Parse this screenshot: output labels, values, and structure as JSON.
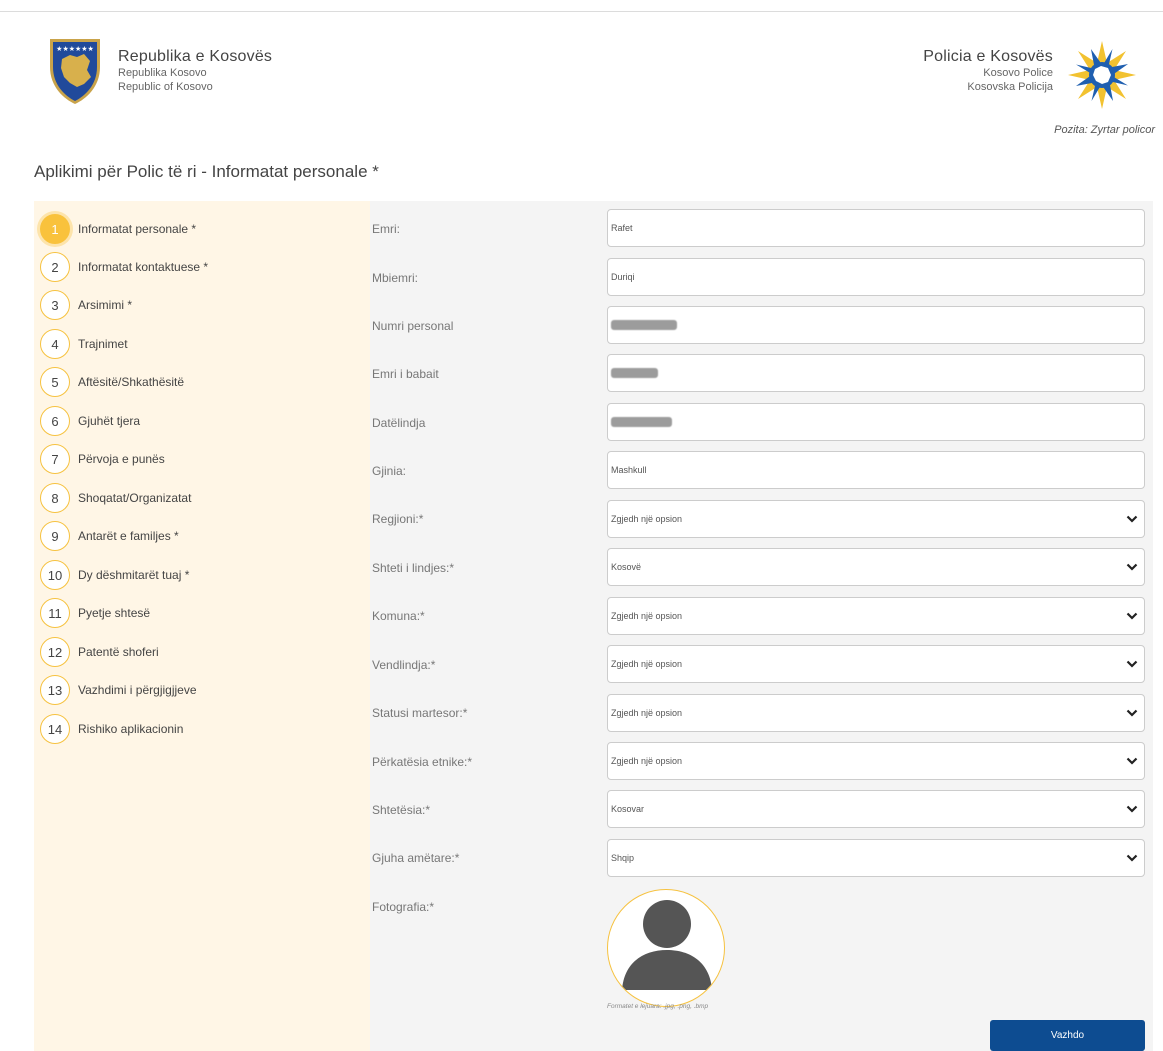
{
  "header": {
    "left": {
      "title": "Republika e Kosovës",
      "sub1": "Republika Kosovo",
      "sub2": "Republic of Kosovo"
    },
    "right": {
      "title": "Policia e Kosovës",
      "sub1": "Kosovo Police",
      "sub2": "Kosovska Policija"
    },
    "pozita": "Pozita: Zyrtar policor"
  },
  "page_title": "Aplikimi për Polic të ri - Informatat personale *",
  "steps": [
    {
      "num": "1",
      "label": "Informatat personale *",
      "active": true
    },
    {
      "num": "2",
      "label": "Informatat kontaktuese *"
    },
    {
      "num": "3",
      "label": "Arsimimi *"
    },
    {
      "num": "4",
      "label": "Trajnimet"
    },
    {
      "num": "5",
      "label": "Aftësitë/Shkathësitë"
    },
    {
      "num": "6",
      "label": "Gjuhët tjera"
    },
    {
      "num": "7",
      "label": "Përvoja e punës"
    },
    {
      "num": "8",
      "label": "Shoqatat/Organizatat"
    },
    {
      "num": "9",
      "label": "Antarët e familjes *"
    },
    {
      "num": "10",
      "label": "Dy dëshmitarët tuaj *"
    },
    {
      "num": "11",
      "label": "Pyetje shtesë"
    },
    {
      "num": "12",
      "label": "Patentë shoferi"
    },
    {
      "num": "13",
      "label": "Vazhdimi i përgjigjjeve"
    },
    {
      "num": "14",
      "label": "Rishiko aplikacionin"
    }
  ],
  "form": {
    "emri": {
      "label": "Emri:",
      "value": "Rafet"
    },
    "mbiemri": {
      "label": "Mbiemri:",
      "value": "Duriqi"
    },
    "numri_personal": {
      "label": "Numri personal"
    },
    "emri_babait": {
      "label": "Emri i babait"
    },
    "datelindja": {
      "label": "Datëlindja"
    },
    "gjinia": {
      "label": "Gjinia:",
      "value": "Mashkull"
    },
    "regjioni": {
      "label": "Regjioni:*",
      "value": "Zgjedh një opsion"
    },
    "shteti_lindjes": {
      "label": "Shteti i lindjes:*",
      "value": "Kosovë"
    },
    "komuna": {
      "label": "Komuna:*",
      "value": "Zgjedh një opsion"
    },
    "vendlindja": {
      "label": "Vendlindja:*",
      "value": "Zgjedh një opsion"
    },
    "statusi_martesor": {
      "label": "Statusi martesor:*",
      "value": "Zgjedh një opsion"
    },
    "perkatesia_etnike": {
      "label": "Përkatësia etnike:*",
      "value": "Zgjedh një opsion"
    },
    "shtetesia": {
      "label": "Shtetësia:*",
      "value": "Kosovar"
    },
    "gjuha_ametare": {
      "label": "Gjuha amëtare:*",
      "value": "Shqip"
    },
    "fotografia": {
      "label": "Fotografia:*",
      "hint": "Formatet e lejuara: .jpg, .png, .bmp"
    }
  },
  "buttons": {
    "next": "Vazhdo"
  },
  "colors": {
    "accent": "#f9c23c",
    "sidebar_bg": "#fff6e6",
    "primary_button": "#0d4c91"
  }
}
